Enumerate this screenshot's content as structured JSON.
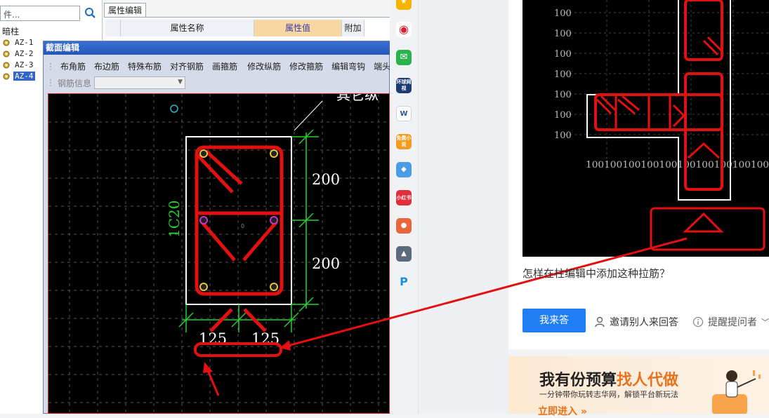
{
  "left_panel": {
    "search_placeholder": "件...",
    "tree_root": "暗柱",
    "items": [
      "AZ-1",
      "AZ-2",
      "AZ-3",
      "AZ-4"
    ]
  },
  "property_panel": {
    "tab": "属性编辑",
    "columns": [
      "属性名称",
      "属性值",
      "附加"
    ]
  },
  "dialog": {
    "title": "截面编辑",
    "toolbar": [
      "布角筋",
      "布边筋",
      "特殊布筋",
      "对齐钢筋",
      "画箍筋",
      "修改纵筋",
      "修改箍筋",
      "编辑弯钩",
      "端头伸缩"
    ],
    "rebar_info_label": "钢筋信息",
    "canvas": {
      "corner_label": "其它纵",
      "dim_vertical_1": "200",
      "dim_vertical_2": "200",
      "dim_horizontal_1": "125",
      "dim_horizontal_2": "125",
      "rebar_label": "1C20",
      "center_mark": "0"
    }
  },
  "sidebar_icons": [
    {
      "name": "star-icon",
      "color": "#f5b400",
      "glyph": "★"
    },
    {
      "name": "weibo-icon",
      "color": "#e6162d",
      "glyph": "◉"
    },
    {
      "name": "mail-icon",
      "color": "#2bb24c",
      "glyph": "✉"
    },
    {
      "name": "news-icon",
      "color": "#1b3b73",
      "glyph": "环球网视",
      "text": "环球网视"
    },
    {
      "name": "word-icon",
      "color": "#2b5797",
      "glyph": "W"
    },
    {
      "name": "novel-icon",
      "color": "#f29b1d",
      "glyph": "免费小说",
      "text": "免费小说"
    },
    {
      "name": "game-icon-1",
      "color": "#4a9be8",
      "glyph": "◆"
    },
    {
      "name": "xiaohongshu-icon",
      "color": "#e02e3c",
      "glyph": "小红书",
      "text": "小红书"
    },
    {
      "name": "game-icon-2",
      "color": "#e8663c",
      "glyph": "●"
    },
    {
      "name": "game-icon-3",
      "color": "#5b6b7d",
      "glyph": "▲"
    },
    {
      "name": "pixiv-icon",
      "color": "#ffffff",
      "glyph": "P"
    }
  ],
  "qa": {
    "image_axis_labels": [
      "100",
      "100",
      "100",
      "100",
      "100",
      "100",
      "100"
    ],
    "image_bottom_axis": "100100100100100100100100100100",
    "question": "怎样在柱编辑中添加这种拉筋？",
    "answer_button": "我来答",
    "invite_text": "邀请别人来回答",
    "remind_text": "提醒提问者"
  },
  "ad": {
    "title_plain": "我有份预算",
    "title_highlight": "找人代做",
    "subtitle": "一分钟带你玩转志华网，解锁平台新玩法",
    "link": "立即进入 »"
  }
}
